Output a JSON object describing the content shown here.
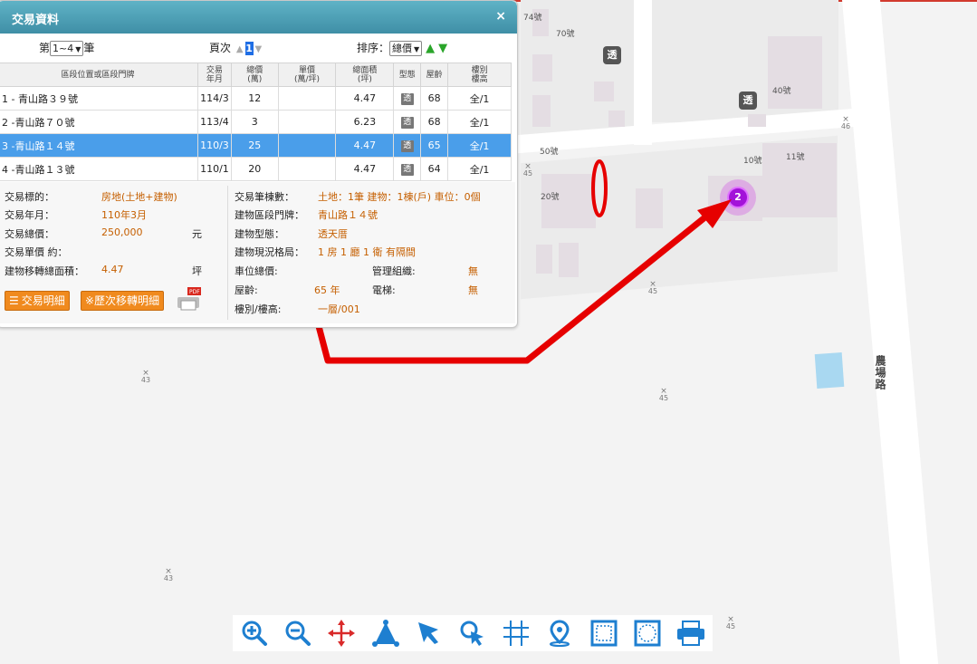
{
  "panel": {
    "title": "交易資料",
    "close_symbol": "×"
  },
  "pager": {
    "records_prefix": "第",
    "records_selected": "1~4",
    "records_suffix": "筆",
    "page_label": "頁次",
    "page_up": "▲",
    "page_current": "1",
    "page_down": "▼",
    "sort_label": "排序：",
    "sort_selected": "總價",
    "sort_asc": "▲",
    "sort_desc": "▼"
  },
  "table": {
    "headers": {
      "location": "區段位置或區段門牌",
      "date": "交易\n年月",
      "total": "總價\n(萬)",
      "unit": "單價\n(萬/坪)",
      "area": "總面積\n(坪)",
      "type": "型態",
      "age": "屋齡",
      "floor": "樓別\n樓高"
    },
    "rows": [
      {
        "location": "1 - 青山路３９號",
        "date": "114/3",
        "total": "12",
        "unit": "",
        "area": "4.47",
        "type": "透",
        "age": "68",
        "floor": "全/1"
      },
      {
        "location": "2 -青山路７０號",
        "date": "113/4",
        "total": "3",
        "unit": "",
        "area": "6.23",
        "type": "透",
        "age": "68",
        "floor": "全/1"
      },
      {
        "location": "3 -青山路１４號",
        "date": "110/3",
        "total": "25",
        "unit": "",
        "area": "4.47",
        "type": "透",
        "age": "65",
        "floor": "全/1"
      },
      {
        "location": "4 -青山路１３號",
        "date": "110/1",
        "total": "20",
        "unit": "",
        "area": "4.47",
        "type": "透",
        "age": "64",
        "floor": "全/1"
      }
    ],
    "selected_row": 2
  },
  "detail": {
    "target_label": "交易標的：",
    "target_value": "房地(土地+建物)",
    "date_label": "交易年月：",
    "date_value": "110年3月",
    "total_label": "交易總價：",
    "total_value": "250,000",
    "total_unit": "元",
    "unitprice_label": "交易單價 約：",
    "area_label": "建物移轉總面積：",
    "area_value": "4.47",
    "area_unit": "坪",
    "count_label": "交易筆棟數：",
    "count_value": "土地：1筆 建物：1棟(戶) 車位：0個",
    "addr_label": "建物區段門牌：",
    "addr_value": "青山路１４號",
    "btype_label": "建物型態：",
    "btype_value": "透天厝",
    "layout_label": "建物現況格局：",
    "layout_value": "1 房 1 廳 1 衛 有隔間",
    "parking_label": "車位總價:",
    "mgmt_label": "管理組織:",
    "mgmt_value": "無",
    "age_label": "屋齡:",
    "age_value": "65 年",
    "elevator_label": "電梯:",
    "elevator_value": "無",
    "floor_label": "樓別/樓高:",
    "floor_value": "一層/001",
    "btn_detail": "交易明細",
    "btn_history": "※歷次移轉明細"
  },
  "map": {
    "addresses": [
      "74號",
      "70號",
      "40號",
      "50號",
      "11號",
      "10號",
      "20號"
    ],
    "elevations": [
      "46",
      "45",
      "45",
      "43",
      "43",
      "45",
      "43",
      "45"
    ],
    "tou_marker": "透",
    "road_name": "農場路",
    "cluster_count": "2"
  },
  "colors": {
    "header": "#4a9fb5",
    "selected_row": "#4a9eea",
    "accent_value": "#c55f00",
    "button": "#f08a1e",
    "cluster": "#a312d9",
    "annotation": "#ff0000"
  },
  "toolbar": {
    "icons": [
      "zoom-in-icon",
      "zoom-out-icon",
      "pan-icon",
      "measure-area-icon",
      "select-arrow-icon",
      "identify-icon",
      "grid-icon",
      "location-pin-icon",
      "frame-select-icon",
      "circle-select-icon",
      "print-icon"
    ]
  }
}
